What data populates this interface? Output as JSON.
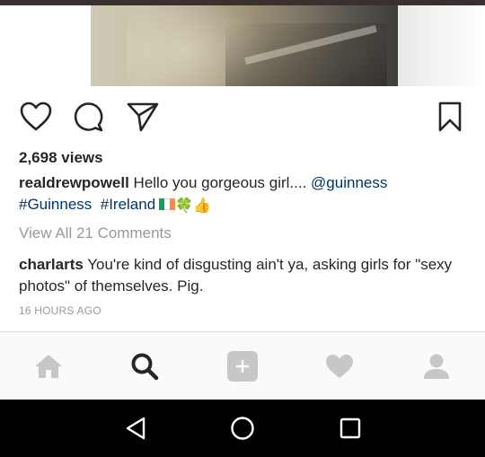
{
  "post": {
    "views": "2,698 views",
    "caption": {
      "username": "realdrewpowell",
      "text": " Hello you gorgeous girl.... ",
      "mention": "@guinness",
      "hashtag1": "#Guinness",
      "hashtag2": "#Ireland",
      "emoji_clover": "🍀",
      "emoji_thumb": "👍"
    },
    "view_all_comments": "View All 21 Comments",
    "comment": {
      "username": "charlarts",
      "text": " You're kind of disgusting ain't ya, asking girls for \"sexy photos\" of themselves. Pig."
    },
    "timestamp": "16 HOURS AGO"
  },
  "actions": [
    "heart-icon",
    "comment-icon",
    "share-icon",
    "bookmark-icon"
  ],
  "tabs": [
    "home-icon",
    "search-icon",
    "add-icon",
    "activity-heart-icon",
    "profile-icon"
  ],
  "android_nav": [
    "back-icon",
    "home-circle-icon",
    "recents-icon"
  ],
  "colors": {
    "link": "#003569",
    "muted": "#999999",
    "text": "#262626",
    "tab_inactive": "#c7c7c7",
    "flag_green": "#169b62",
    "flag_white": "#ffffff",
    "flag_orange": "#ff883e"
  }
}
